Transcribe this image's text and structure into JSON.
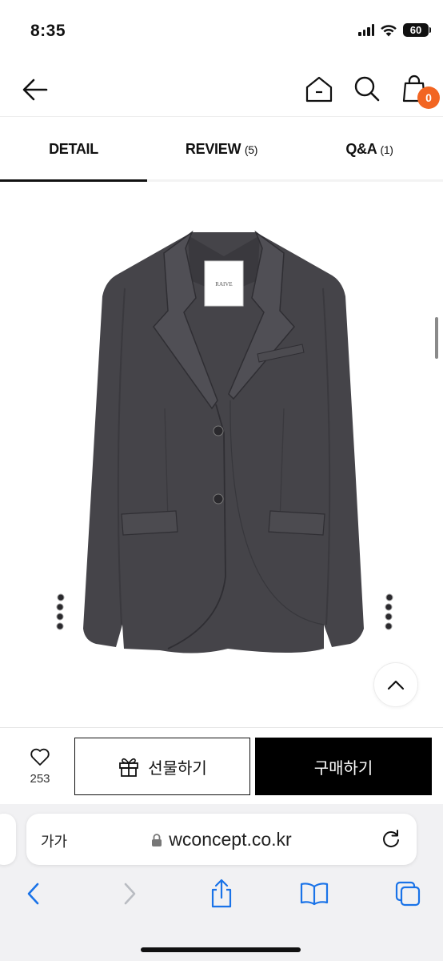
{
  "status": {
    "time": "8:35",
    "battery": "60"
  },
  "cart": {
    "count": "0"
  },
  "tabs": [
    {
      "label": "DETAIL",
      "count": ""
    },
    {
      "label": "REVIEW",
      "count": "(5)"
    },
    {
      "label": "Q&A",
      "count": "(1)"
    }
  ],
  "product": {
    "label_text": "RAIVE"
  },
  "actions": {
    "like_count": "253",
    "gift_label": "선물하기",
    "buy_label": "구매하기"
  },
  "browser": {
    "text_size_label": "가가",
    "url": "wconcept.co.kr"
  },
  "colors": {
    "accent": "#f26522",
    "buy_button": "#000000",
    "jacket": "#454449"
  }
}
